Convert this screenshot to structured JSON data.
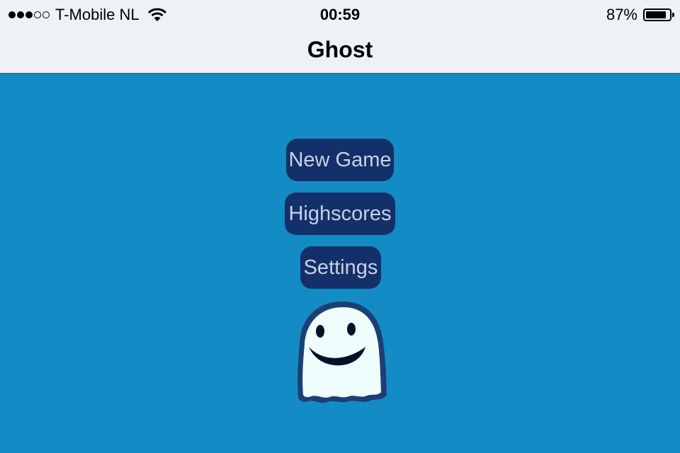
{
  "status_bar": {
    "signal_filled": 3,
    "signal_total": 5,
    "carrier": "T-Mobile NL",
    "time": "00:59",
    "battery_percent": "87%",
    "battery_level": 0.87
  },
  "nav": {
    "title": "Ghost"
  },
  "menu": {
    "new_game": "New Game",
    "highscores": "Highscores",
    "settings": "Settings"
  },
  "colors": {
    "background": "#138bc4",
    "button": "#14306a",
    "button_text": "#c8d2e4",
    "bar": "#eff2f5"
  },
  "icons": {
    "ghost": "ghost-mascot-icon",
    "wifi": "wifi-icon",
    "battery": "battery-icon"
  }
}
